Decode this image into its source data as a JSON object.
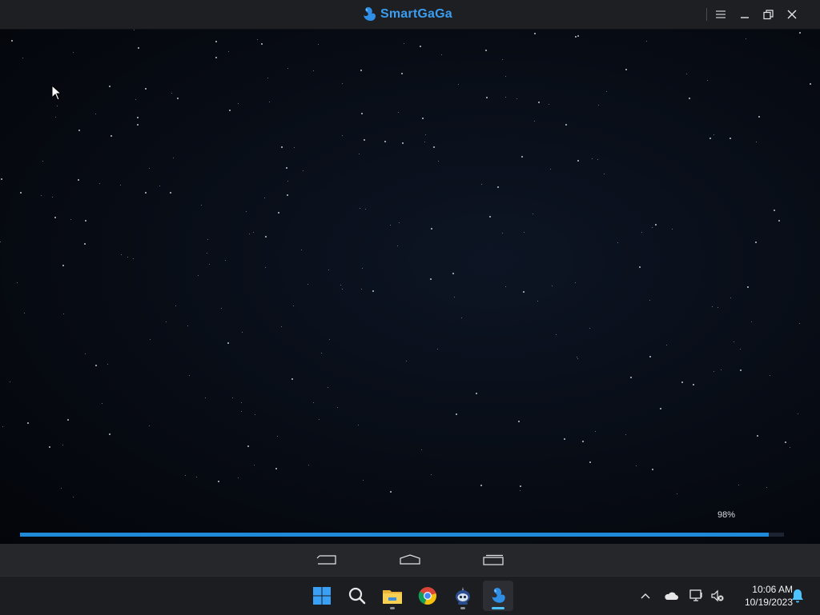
{
  "titlebar": {
    "app_name": "SmartGaGa",
    "icons": {
      "logo": "swan-logo-icon",
      "menu": "hamburger-menu-icon",
      "minimize": "minimize-icon",
      "restore": "restore-icon",
      "close": "close-icon"
    },
    "accent_color": "#3a9df0"
  },
  "splash": {
    "progress_text": "98%",
    "progress_value": 0.98,
    "progress_color": "#1f8ad8"
  },
  "navbar": {
    "buttons": [
      "back-icon",
      "home-icon",
      "recent-apps-icon"
    ]
  },
  "taskbar": {
    "apps": [
      {
        "name": "windows-start-icon",
        "running": false,
        "active": false
      },
      {
        "name": "search-icon",
        "running": false,
        "active": false
      },
      {
        "name": "file-explorer-icon",
        "running": true,
        "active": false
      },
      {
        "name": "chrome-icon",
        "running": false,
        "active": false
      },
      {
        "name": "robot-app-icon",
        "running": true,
        "active": false
      },
      {
        "name": "smartgaga-icon",
        "running": true,
        "active": true
      }
    ],
    "tray": {
      "icons": [
        "chevron-up-icon",
        "onedrive-cloud-icon",
        "network-icon",
        "volume-muted-icon",
        "notification-bell-icon"
      ],
      "time": "10:06 AM",
      "date": "10/19/2023"
    }
  }
}
